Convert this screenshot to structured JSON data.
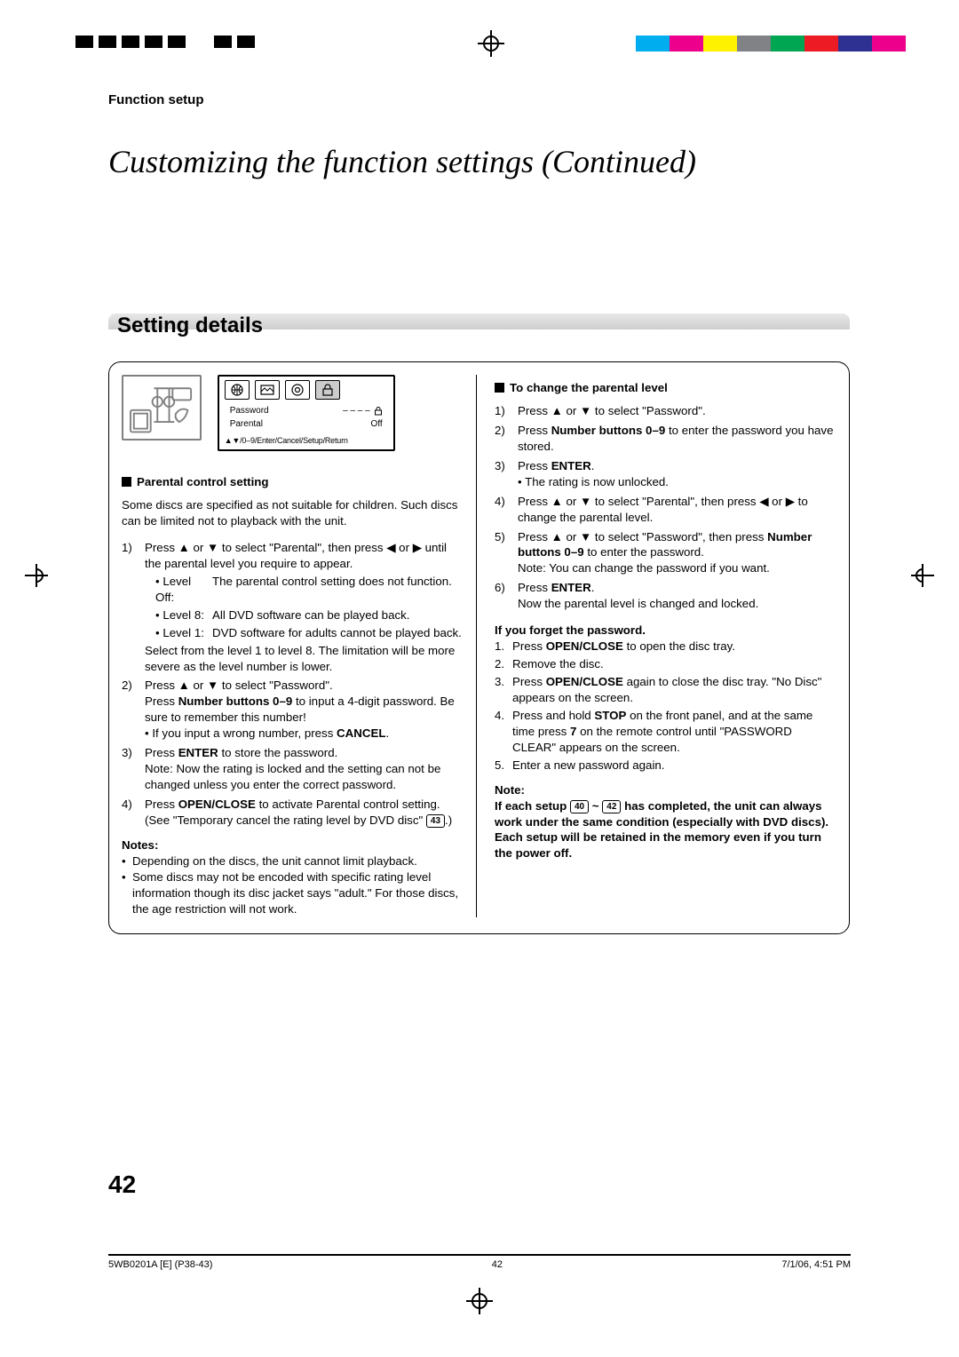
{
  "header": {
    "section": "Function setup",
    "title": "Customizing the function settings (Continued)",
    "subhead": "Setting details"
  },
  "osd": {
    "rows": [
      {
        "label": "Password",
        "value": "– – – –",
        "lock": true
      },
      {
        "label": "Parental",
        "value": "Off",
        "lock": false
      }
    ],
    "footer": "▲▼/0–9/Enter/Cancel/Setup/Return"
  },
  "left": {
    "h1": "Parental control setting",
    "intro": "Some discs are specified as not suitable for children. Such discs can be limited not to playback with the unit.",
    "steps": {
      "s1a": "Press ▲ or ▼ to select \"Parental\", then press ◀ or ▶ until the parental level you require to appear.",
      "lvloff_l": "• Level Off:",
      "lvloff_d": "The parental control setting does not function.",
      "lvl8_l": "• Level 8:",
      "lvl8_d": "All DVD software can be played back.",
      "lvl1_l": "• Level 1:",
      "lvl1_d": "DVD software for adults cannot be played back.",
      "s1b": "Select from the level 1 to level 8. The limitation will be more severe as the level number is lower.",
      "s2a": "Press ▲ or ▼ to select \"Password\".",
      "s2b_pre": "Press ",
      "s2b_btn": "Number buttons 0–9",
      "s2b_post": " to input a 4-digit password. Be sure to remember this number!",
      "s2c": "• If you input a wrong number, press ",
      "s2c_cancel": "CANCEL",
      "s2c_end": ".",
      "s3a": "Press ",
      "s3a_b": "ENTER",
      "s3a_post": " to store the password.",
      "s3b": "Note: Now the rating is locked and the setting can not be changed unless you enter the correct password.",
      "s4a": "Press ",
      "s4a_b": "OPEN/CLOSE",
      "s4a_post": " to activate Parental control setting. (See \"Temporary cancel the rating level by DVD disc\" ",
      "s4ref": "43",
      "s4end": ".)"
    },
    "notes_h": "Notes:",
    "notes": [
      "Depending on the discs, the unit cannot limit playback.",
      "Some discs may not be encoded with specific rating level information though its disc jacket says \"adult.\" For those discs, the age restriction will not work."
    ]
  },
  "right": {
    "h1": "To change the parental level",
    "steps": {
      "r1": "Press ▲ or ▼ to select \"Password\".",
      "r2_pre": "Press ",
      "r2_b": "Number buttons 0–9",
      "r2_post": " to enter the password you have stored.",
      "r3_pre": "Press ",
      "r3_b": "ENTER",
      "r3_post": ".",
      "r3sub": "• The rating is now unlocked.",
      "r4": "Press ▲ or ▼ to select \"Parental\", then press ◀ or ▶ to change the parental level.",
      "r5_pre": "Press ▲ or ▼ to select \"Password\", then press ",
      "r5_b": "Number buttons 0–9",
      "r5_post": " to enter the password.",
      "r5note": "Note: You can change the password if you want.",
      "r6_pre": "Press ",
      "r6_b": "ENTER",
      "r6_post": ".",
      "r6sub": "Now the parental level is changed and locked."
    },
    "forget_h": "If you forget the password.",
    "forget": {
      "f1_pre": "Press ",
      "f1_b": "OPEN/CLOSE",
      "f1_post": " to open the disc tray.",
      "f2": "Remove the disc.",
      "f3_pre": "Press ",
      "f3_b": "OPEN/CLOSE",
      "f3_post": " again to close the disc tray. \"No Disc\" appears on the screen.",
      "f4_pre": "Press and hold ",
      "f4_b1": "STOP",
      "f4_mid": " on the front panel, and at the same time press ",
      "f4_b2": "7",
      "f4_post": " on the remote control until \"PASSWORD CLEAR\" appears on the screen.",
      "f5": "Enter a new password again."
    },
    "note_h": "Note:",
    "note_pre": "If each setup ",
    "note_ref1": "40",
    "note_mid": " ~ ",
    "note_ref2": "42",
    "note_post": " has completed, the unit can always work under the same condition (especially with DVD discs). Each setup will be retained in the memory even if you turn the power off."
  },
  "page_number": "42",
  "footer": {
    "left": "5WB0201A [E] (P38-43)",
    "center": "42",
    "right": "7/1/06, 4:51 PM"
  },
  "reg_colors": [
    "#00aeef",
    "#ec008c",
    "#fff200",
    "#808285",
    "#00a651",
    "#ed1c24",
    "#2e3192",
    "#ec008c"
  ]
}
